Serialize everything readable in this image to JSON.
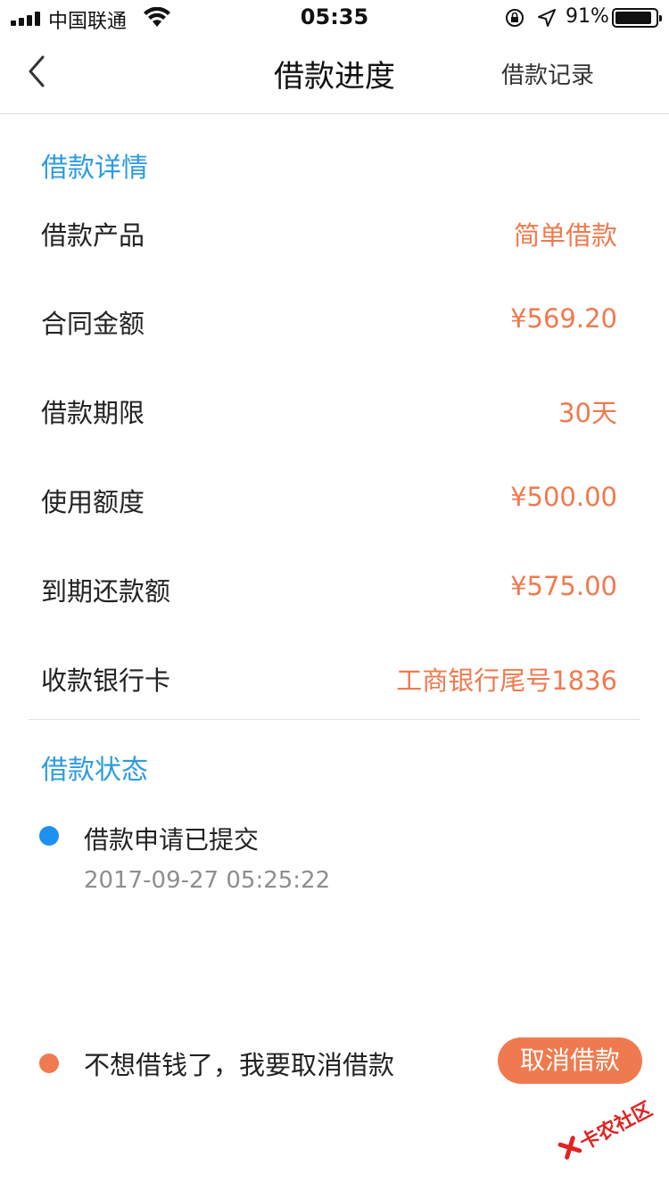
{
  "status_bar": {
    "carrier": "中国联通",
    "time": "05:35",
    "battery_percent": "91%",
    "battery_level": 0.91
  },
  "nav": {
    "back_icon": "chevron-left-icon",
    "title": "借款进度",
    "right_label": "借款记录"
  },
  "details": {
    "section_title": "借款详情",
    "rows": [
      {
        "label": "借款产品",
        "value": "简单借款"
      },
      {
        "label": "合同金额",
        "value": "¥569.20"
      },
      {
        "label": "借款期限",
        "value": "30天"
      },
      {
        "label": "使用额度",
        "value": "¥500.00"
      },
      {
        "label": "到期还款额",
        "value": "¥575.00"
      },
      {
        "label": "收款银行卡",
        "value": "工商银行尾号1836"
      }
    ]
  },
  "status": {
    "section_title": "借款状态",
    "items": [
      {
        "text": "借款申请已提交",
        "time": "2017-09-27 05:25:22"
      }
    ]
  },
  "cancel": {
    "prompt": "不想借钱了，我要取消借款",
    "button_label": "取消借款"
  },
  "watermark": {
    "text": "卡农社区"
  },
  "colors": {
    "accent_blue": "#2d9be0",
    "value_orange": "#f07a4f",
    "status_dot_blue": "#1e90f0"
  }
}
